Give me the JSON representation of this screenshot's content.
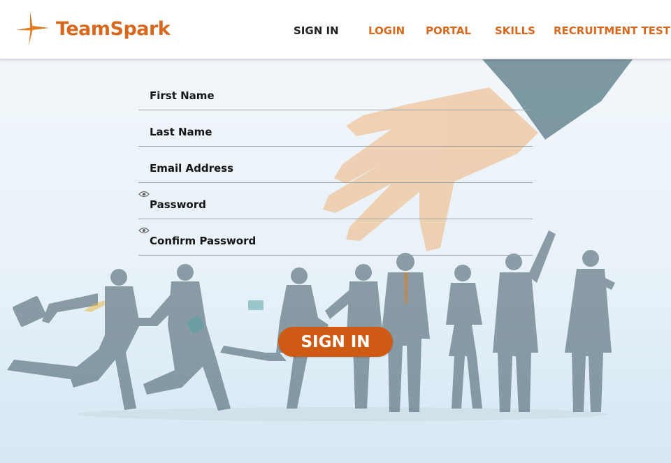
{
  "header": {
    "logo_text": "TeamSpark",
    "nav": {
      "sign_in": "SIGN IN",
      "login": "LOGIN",
      "portal": "PORTAL",
      "skills": "SKILLS",
      "recruitment_test": "RECRUITMENT TEST"
    }
  },
  "form": {
    "first_name": "First Name",
    "last_name": "Last Name",
    "email": "Email Address",
    "password": "Password",
    "confirm_password": "Confirm Password",
    "submit_label": "SIGN IN"
  },
  "icons": {
    "logo": "star-burst-icon",
    "password_toggle": "eye-icon"
  },
  "colors": {
    "accent": "#d7681d",
    "button": "#cf5a14",
    "hero_bg": "#e7f1f8"
  }
}
